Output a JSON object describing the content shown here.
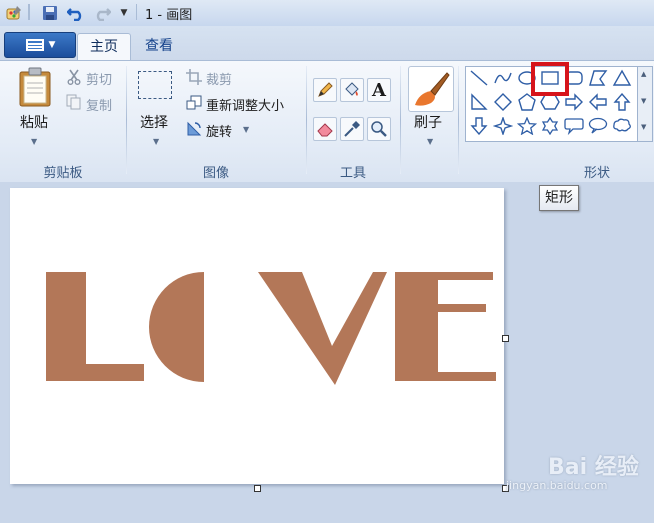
{
  "window": {
    "title": "1 - 画图"
  },
  "tabs": {
    "home": "主页",
    "view": "查看"
  },
  "clipboard": {
    "paste": "粘贴",
    "cut": "剪切",
    "copy": "复制",
    "group": "剪贴板"
  },
  "image": {
    "select": "选择",
    "crop": "裁剪",
    "resize": "重新调整大小",
    "rotate": "旋转",
    "group": "图像"
  },
  "tools": {
    "group": "工具"
  },
  "brushes": {
    "label": "刷子"
  },
  "shapes": {
    "group": "形状"
  },
  "tooltip": {
    "text": "矩形"
  },
  "canvas": {
    "text": "LOVE",
    "text_color": "#b37758"
  },
  "watermark": {
    "brand": "Bai 经验",
    "url": "jingyan.baidu.com"
  },
  "colors": {
    "accent_highlight": "#d6141b",
    "ribbon_text": "#3b5a83"
  }
}
